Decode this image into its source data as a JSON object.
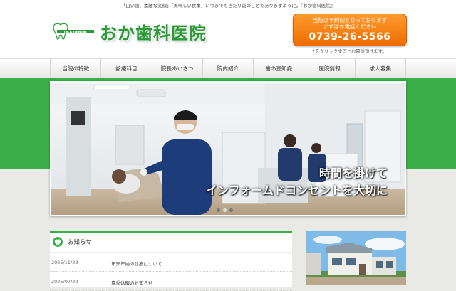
{
  "header": {
    "tagline": "「白い歯、素敵な笑顔」「美味しい食事」いつまでも当たり前のことでありますように。『おか歯科医院』",
    "logo_small": "OKA DENTAL",
    "title": "おか歯科医院",
    "call": {
      "line1": "当院は予約制となっております",
      "line2": "まずはお電話ください",
      "phone": "0739-26-5566",
      "note": "↑をクリックするとお電話頂けます。"
    }
  },
  "nav": {
    "items": [
      "当院の特徴",
      "診療科目",
      "院長あいさつ",
      "院内紹介",
      "歯の豆知識",
      "医院情報",
      "求人募集"
    ]
  },
  "hero": {
    "caption_line1": "時間を掛けて",
    "caption_line2": "インフォームドコンセントを大切に",
    "slides": 3,
    "active_slide": 2
  },
  "news": {
    "title": "お知らせ",
    "items": [
      {
        "date": "2025/11/28",
        "text": "年末年始の診療について"
      },
      {
        "date": "2025/07/29",
        "text": "夏季休暇のお知らせ"
      }
    ]
  },
  "colors": {
    "brand_green": "#3cae47",
    "call_orange": "#f07d10"
  }
}
